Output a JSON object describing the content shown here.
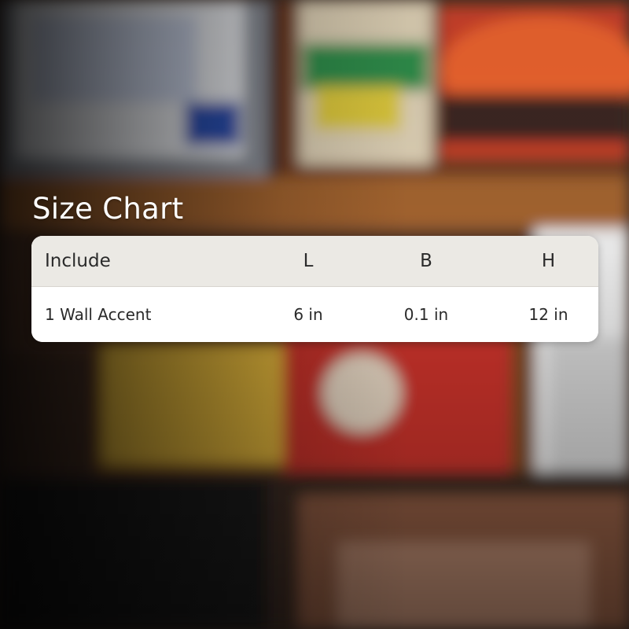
{
  "title": "Size Chart",
  "table": {
    "headers": [
      "Include",
      "L",
      "B",
      "H"
    ],
    "rows": [
      [
        "1 Wall Accent",
        "6 in",
        "0.1 in",
        "12 in"
      ]
    ]
  },
  "colors": {
    "header_bg": "#ebe9e4",
    "body_bg": "#ffffff",
    "text": "#2a2a2a",
    "title": "#ffffff"
  }
}
